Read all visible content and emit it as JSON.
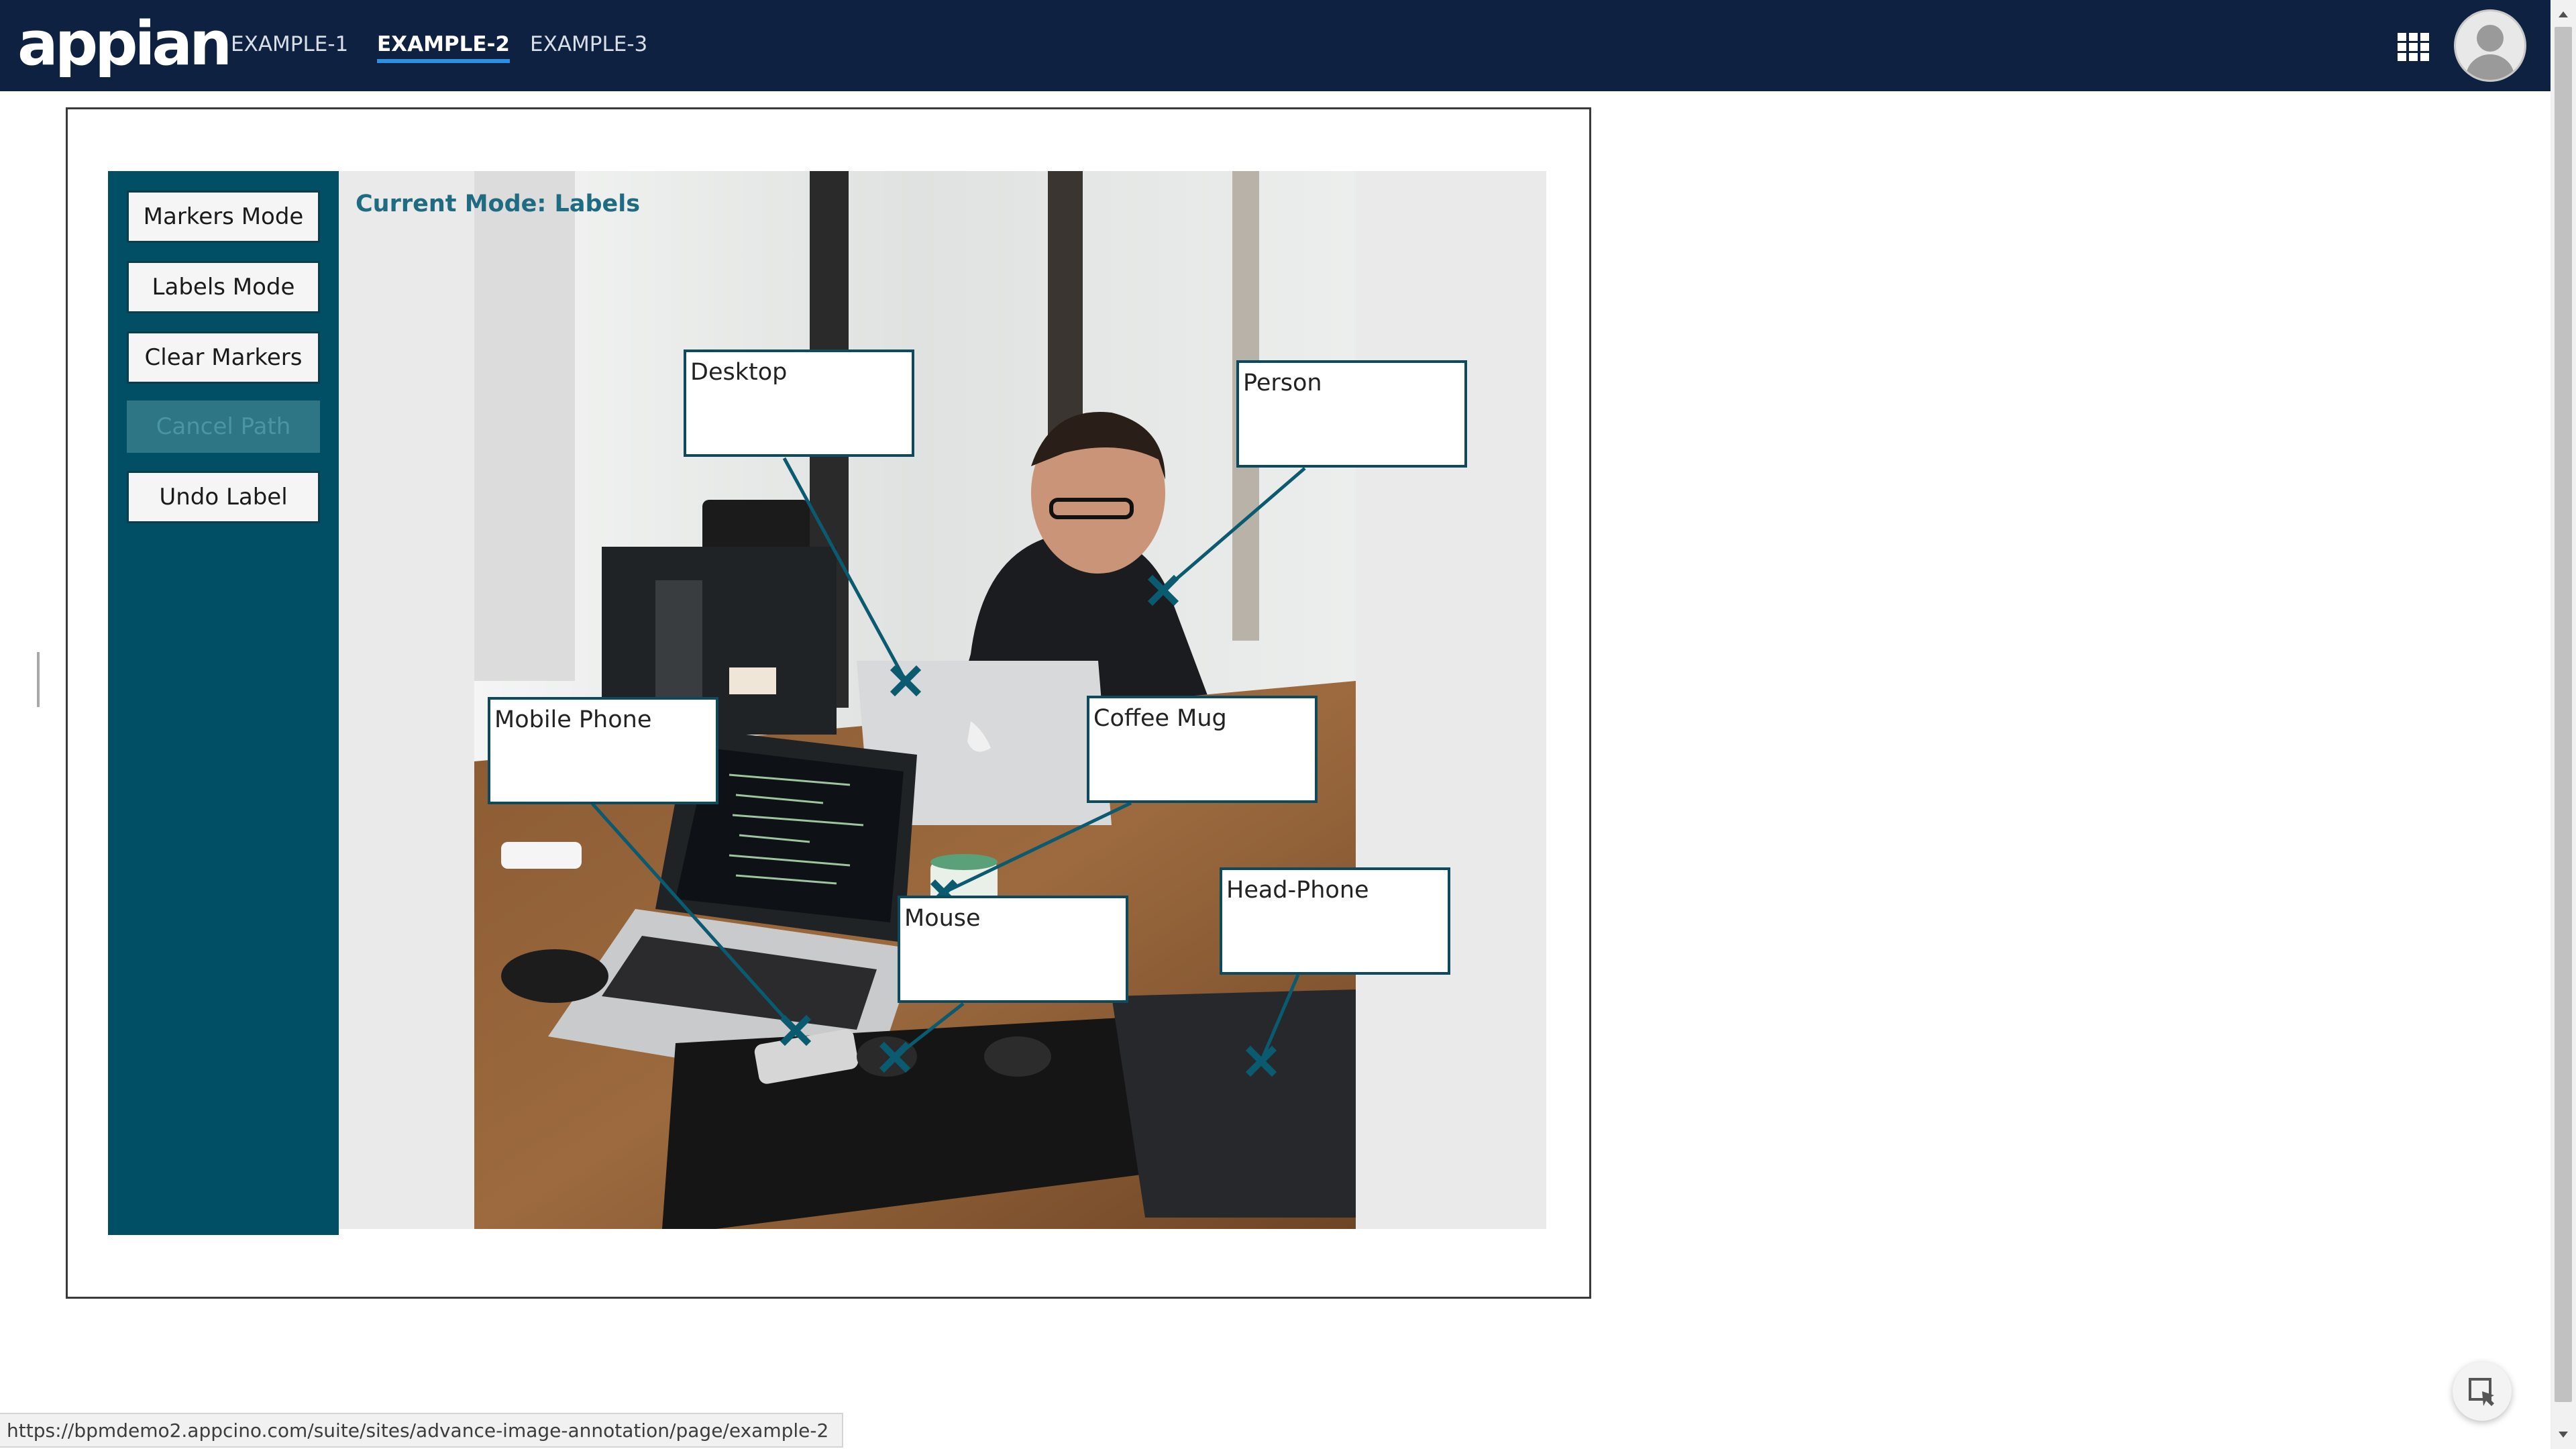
{
  "nav": {
    "logo": "appian",
    "tabs": [
      {
        "label": "EXAMPLE-1",
        "active": false
      },
      {
        "label": "EXAMPLE-2",
        "active": true
      },
      {
        "label": "EXAMPLE-3",
        "active": false
      }
    ],
    "apps_icon": "grid-icon",
    "avatar_icon": "user-avatar-icon"
  },
  "tools": {
    "markers_mode": "Markers Mode",
    "labels_mode": "Labels Mode",
    "clear_markers": "Clear Markers",
    "cancel_path": "Cancel Path",
    "cancel_path_disabled": true,
    "undo_label": "Undo Label"
  },
  "canvas": {
    "current_mode": "Current Mode: Labels",
    "labels": [
      {
        "text": "Desktop"
      },
      {
        "text": "Person"
      },
      {
        "text": "Mobile Phone"
      },
      {
        "text": "Coffee Mug"
      },
      {
        "text": "Mouse"
      },
      {
        "text": "Head-Phone"
      }
    ]
  },
  "status": {
    "url": "https://bpmdemo2.appcino.com/suite/sites/advance-image-annotation/page/example-2"
  },
  "colors": {
    "topbar": "#0f2140",
    "panel": "#014f64",
    "accent_text": "#1e6b82",
    "link_line": "#0a5a70"
  }
}
